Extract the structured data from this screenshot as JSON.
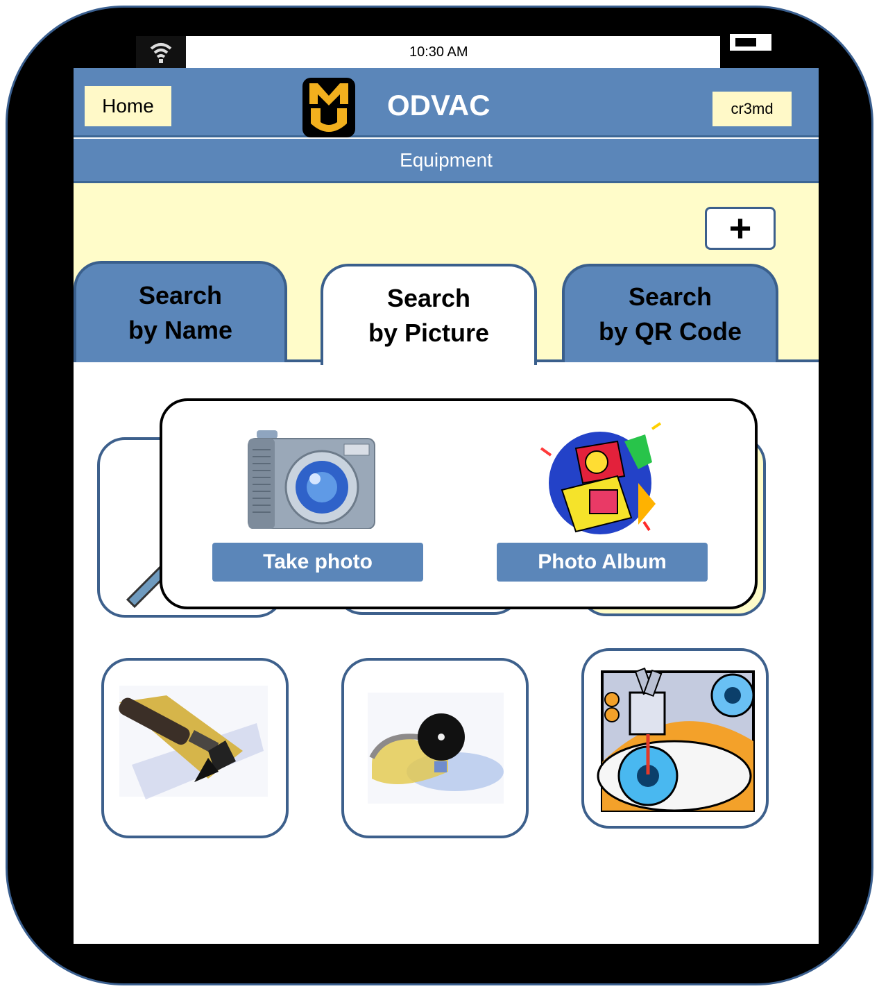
{
  "status": {
    "time": "10:30 AM"
  },
  "header": {
    "home_label": "Home",
    "title": "ODVAC",
    "user_label": "cr3md",
    "logo_letters": "MU"
  },
  "subheader": {
    "title": "Equipment"
  },
  "add_button": {
    "label": "+"
  },
  "tabs": [
    {
      "line1": "Search",
      "line2": "by Name",
      "active": false
    },
    {
      "line1": "Search",
      "line2": "by Picture",
      "active": true
    },
    {
      "line1": "Search",
      "line2": "by QR Code",
      "active": false
    }
  ],
  "popup": {
    "take_photo_label": "Take photo",
    "photo_album_label": "Photo Album"
  },
  "colors": {
    "brand_blue": "#5b86b9",
    "border_blue": "#3a5f8c",
    "cream": "#fffcc9",
    "button_cream": "#fff9c8",
    "gold": "#f2b01e"
  },
  "icons": [
    "wifi-icon",
    "battery-icon",
    "mizzou-logo",
    "plus-icon",
    "camera-icon",
    "photo-album-icon",
    "magnifier-tool-icon",
    "otoscope-icon",
    "head-mirror-icon",
    "eye-microscope-icon"
  ]
}
